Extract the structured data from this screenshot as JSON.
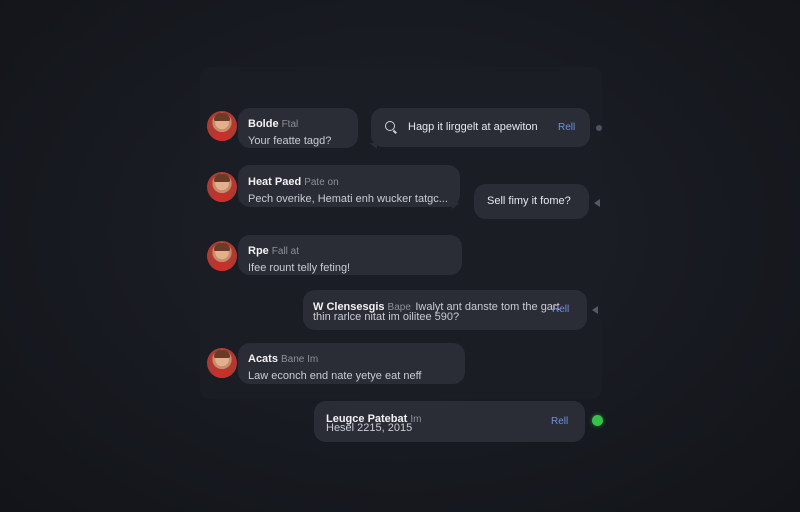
{
  "messages": [
    {
      "name": "Bolde",
      "meta": "Ftal",
      "text": "Your featte tagd?"
    },
    {
      "name": "Heat Paed",
      "meta": "Pate on",
      "text": "Pech overike, Hemati enh wucker tatgc..."
    },
    {
      "name": "Rpe",
      "meta": "Fall at",
      "text": "Ifee rount telly feting!"
    },
    {
      "name": "Acats",
      "meta": "Bane Im",
      "text": "Law econch end nate yetye eat neff"
    }
  ],
  "outgoing": [
    {
      "text": "Hagp it lirggelt at apewiton",
      "reply": "Rell"
    },
    {
      "text": "Sell fimy it fome?"
    },
    {
      "name": "W Clensesgis",
      "meta": "Bape",
      "line1": "Iwalyt ant danste tom the gart",
      "line2": "thin rarlce nitat im oilitee 590?",
      "reply": "Rell"
    },
    {
      "name": "Leugce Patebat",
      "meta": "Im",
      "line2": "Hesel 2215, 2015",
      "reply": "Rell"
    }
  ],
  "colors": {
    "background": "#171a20",
    "panel": "#1a1d24",
    "bubble": "#2a2d35",
    "accent": "#6f8fe0",
    "online": "#35c14a"
  },
  "icons": {
    "search": "search-icon",
    "online": "online-status-icon"
  }
}
